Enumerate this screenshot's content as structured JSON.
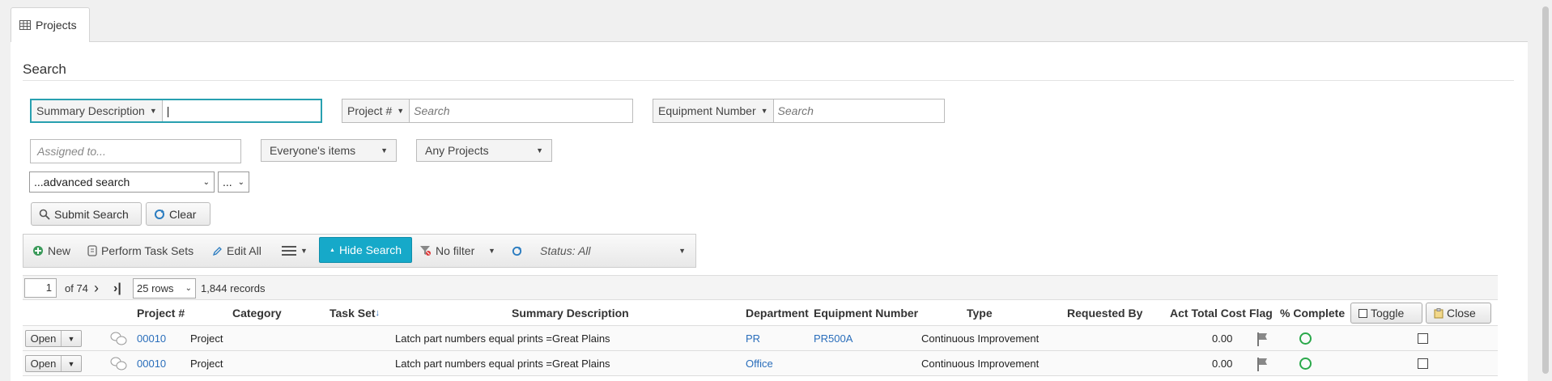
{
  "tab": {
    "label": "Projects"
  },
  "search": {
    "heading": "Search",
    "summary": {
      "field": "Summary Description",
      "value": "|"
    },
    "project": {
      "field": "Project #",
      "placeholder": "Search"
    },
    "equipment": {
      "field": "Equipment Number",
      "placeholder": "Search"
    },
    "assigned_placeholder": "Assigned to...",
    "items_filter": "Everyone's items",
    "projects_filter": "Any Projects",
    "advanced": "...advanced search",
    "more": "...",
    "submit": "Submit Search",
    "clear": "Clear"
  },
  "toolbar": {
    "new": "New",
    "task_sets": "Perform Task Sets",
    "edit_all": "Edit All",
    "hide_search": "Hide Search",
    "no_filter": "No filter",
    "status": "Status: All"
  },
  "pager": {
    "page": "1",
    "of": "of 74",
    "rows": "25 rows",
    "records": "1,844 records"
  },
  "columns": {
    "project_no": "Project #",
    "category": "Category",
    "task_set": "Task Set",
    "summary": "Summary Description",
    "department": "Department",
    "equipment": "Equipment Number",
    "type": "Type",
    "requested_by": "Requested By",
    "cost": "Act Total Cost",
    "flag": "Flag",
    "complete": "% Complete",
    "toggle": "Toggle",
    "close": "Close"
  },
  "rows": [
    {
      "action": "Open",
      "project_no": "00010",
      "category": "Project",
      "summary": "Latch part numbers equal prints =Great Plains",
      "department": "PR",
      "equipment": "PR500A",
      "type": "Continuous Improvement",
      "cost": "0.00"
    },
    {
      "action": "Open",
      "project_no": "00010",
      "category": "Project",
      "summary": "Latch part numbers equal prints =Great Plains",
      "department": "Office",
      "equipment": "",
      "type": "Continuous Improvement",
      "cost": "0.00"
    }
  ],
  "colors": {
    "accent": "#16a9c9",
    "link": "#2a6ebb",
    "complete": "#2aa84a"
  }
}
